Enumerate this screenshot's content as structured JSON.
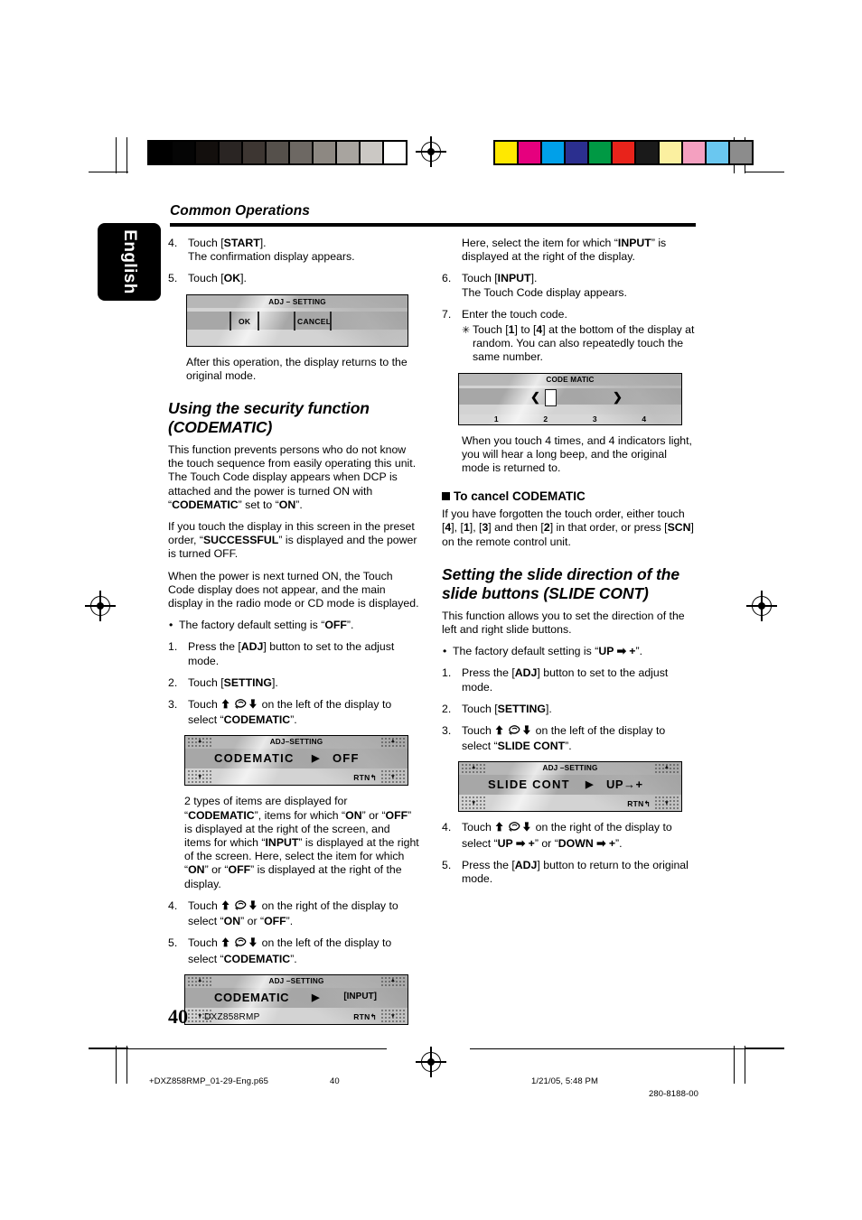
{
  "document": {
    "running_head": "Common Operations",
    "language_tab": "English",
    "page_number": "40",
    "model_name": "DXZ858RMP"
  },
  "colorbars": {
    "grayscale": [
      "#000000",
      "#050505",
      "#130f0d",
      "#2a2523",
      "#3d3632",
      "#55504b",
      "#6d6863",
      "#8d8882",
      "#a8a49f",
      "#cbc8c4",
      "#ffffff"
    ],
    "color": [
      "#ffe800",
      "#e6007e",
      "#00a0e9",
      "#2b2f8f",
      "#009944",
      "#e8231b",
      "#1a1a1a",
      "#fbf0a0",
      "#f4a0c0",
      "#6ac7f0",
      "#8c8c8c"
    ]
  },
  "left_column": {
    "step4": {
      "num": "4.",
      "line1_pre": "Touch [",
      "line1_bold": "START",
      "line1_post": "].",
      "line2": "The confirmation display appears."
    },
    "step5": {
      "num": "5.",
      "line1_pre": "Touch [",
      "line1_bold": "OK",
      "line1_post": "]."
    },
    "lcd_ok_cancel": {
      "title": "ADJ – SETTING",
      "ok_label": "OK",
      "cancel_label": "CANCEL"
    },
    "after_note": "After this operation, the display returns to the original mode.",
    "section_title": "Using the security function (CODEMATIC)",
    "para1_a": "This function prevents persons who do not know the touch sequence from easily operating this unit. The Touch Code display appears when DCP is attached and the power is turned ON with “",
    "para1_b": "CODEMATIC",
    "para1_c": "” set to “",
    "para1_d": "ON",
    "para1_e": "”.",
    "para2_a": "If you touch the display in this screen in the preset order, “",
    "para2_b": "SUCCESSFUL",
    "para2_c": "” is displayed and the power is turned OFF.",
    "para3": "When the power is next turned ON, the Touch Code display does not appear, and the main display in the radio mode or CD mode is displayed.",
    "default_bullet_a": "The factory default setting is “",
    "default_bullet_b": "OFF",
    "default_bullet_c": "”.",
    "step1": {
      "num": "1.",
      "a": "Press the [",
      "b": "ADJ",
      "c": "] button to set to the adjust mode."
    },
    "step2": {
      "num": "2.",
      "a": "Touch [",
      "b": "SETTING",
      "c": "]."
    },
    "step3": {
      "num": "3.",
      "a": "Touch ",
      "b": " on the left of the display to select “",
      "c": "CODEMATIC",
      "d": "”."
    },
    "lcd_codematic_off": {
      "title": "ADJ–SETTING",
      "item": "CODEMATIC",
      "arrow": "▶",
      "value": "OFF",
      "rtn": "RTN"
    },
    "para4_a": "2 types of items are displayed for “",
    "para4_b": "CODEMATIC",
    "para4_c": "”, items for which “",
    "para4_d": "ON",
    "para4_e": "” or “",
    "para4_f": "OFF",
    "para4_g": "” is displayed at the right of the screen, and items for which “",
    "para4_h": "INPUT",
    "para4_i": "” is displayed at the right of the screen. Here, select the item for which “",
    "para4_j": "ON",
    "para4_k": "” or “",
    "para4_l": "OFF",
    "para4_m": "” is displayed at the right of the display.",
    "step4b": {
      "num": "4.",
      "a": "Touch ",
      "b": " on the right of the display to select “",
      "c": "ON",
      "d": "” or “",
      "e": "OFF",
      "f": "”."
    },
    "step5b": {
      "num": "5.",
      "a": "Touch ",
      "b": " on the left of the display to select “",
      "c": "CODEMATIC",
      "d": "”."
    },
    "lcd_codematic_input": {
      "title": "ADJ –SETTING",
      "item": "CODEMATIC",
      "arrow": "▶",
      "value": "[INPUT]",
      "rtn": "RTN"
    }
  },
  "right_column": {
    "intro_a": "Here, select the item for which “",
    "intro_b": "INPUT",
    "intro_c": "” is displayed at the right of the display.",
    "step6": {
      "num": "6.",
      "a": "Touch [",
      "b": "INPUT",
      "c": "].",
      "line2": "The Touch Code display appears."
    },
    "step7": {
      "num": "7.",
      "text": "Enter the touch code."
    },
    "step7_sub": {
      "a": "Touch [",
      "b": "1",
      "c": "] to [",
      "d": "4",
      "e": "] at the bottom of the display at random. You can also repeatedly touch the same number."
    },
    "lcd_codematic": {
      "title": "CODE MATIC",
      "left_chevron": "❮",
      "right_chevron": "❯",
      "numbers": [
        "1",
        "2",
        "3",
        "4"
      ]
    },
    "para_beep": "When you touch 4 times, and 4 indicators light, you will hear a long beep, and the original mode is returned to.",
    "cancel_heading": "To cancel CODEMATIC",
    "cancel_a": "If you have forgotten the touch order, either touch [",
    "cancel_b": "4",
    "cancel_c": "], [",
    "cancel_d": "1",
    "cancel_e": "], [",
    "cancel_f": "3",
    "cancel_g": "] and then [",
    "cancel_h": "2",
    "cancel_i": "] in that order, or press [",
    "cancel_j": "SCN",
    "cancel_k": "] on the remote control unit.",
    "section_title": "Setting the slide direction of the slide buttons (SLIDE CONT)",
    "slide_intro": "This function allows you to set the direction of the left and right slide buttons.",
    "slide_default_a": "The factory default setting is “",
    "slide_default_b": "UP ➡ +",
    "slide_default_c": "”.",
    "slide_step1": {
      "num": "1.",
      "a": "Press the [",
      "b": "ADJ",
      "c": "] button to set to the adjust mode."
    },
    "slide_step2": {
      "num": "2.",
      "a": "Touch [",
      "b": "SETTING",
      "c": "]."
    },
    "slide_step3": {
      "num": "3.",
      "a": "Touch ",
      "b": " on the left of the display to select “",
      "c": "SLIDE CONT",
      "d": "”."
    },
    "lcd_slide_cont": {
      "title": "ADJ –SETTING",
      "item": "SLIDE  CONT",
      "arrow": "▶",
      "value": "UP→+",
      "rtn": "RTN"
    },
    "slide_step4": {
      "num": "4.",
      "a": "Touch ",
      "b": " on the right of the display to select “",
      "c": "UP ➡ +",
      "d": "”  or “",
      "e": "DOWN ➡ +",
      "f": "”."
    },
    "slide_step5": {
      "num": "5.",
      "a": "Press the [",
      "b": "ADJ",
      "c": "] button to return to the original mode."
    }
  },
  "footer": {
    "filename": "+DXZ858RMP_01-29-Eng.p65",
    "page": "40",
    "timestamp": "1/21/05, 5:48 PM",
    "partnumber": "280-8188-00"
  }
}
